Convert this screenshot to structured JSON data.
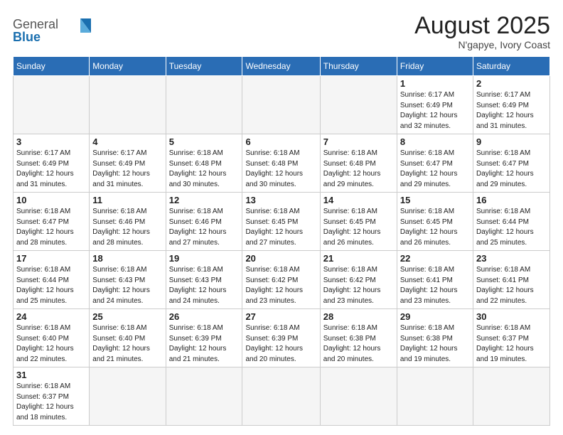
{
  "logo": {
    "text_general": "General",
    "text_blue": "Blue"
  },
  "title": {
    "month_year": "August 2025",
    "location": "N'gapye, Ivory Coast"
  },
  "weekdays": [
    "Sunday",
    "Monday",
    "Tuesday",
    "Wednesday",
    "Thursday",
    "Friday",
    "Saturday"
  ],
  "weeks": [
    [
      {
        "day": "",
        "info": ""
      },
      {
        "day": "",
        "info": ""
      },
      {
        "day": "",
        "info": ""
      },
      {
        "day": "",
        "info": ""
      },
      {
        "day": "",
        "info": ""
      },
      {
        "day": "1",
        "info": "Sunrise: 6:17 AM\nSunset: 6:49 PM\nDaylight: 12 hours\nand 32 minutes."
      },
      {
        "day": "2",
        "info": "Sunrise: 6:17 AM\nSunset: 6:49 PM\nDaylight: 12 hours\nand 31 minutes."
      }
    ],
    [
      {
        "day": "3",
        "info": "Sunrise: 6:17 AM\nSunset: 6:49 PM\nDaylight: 12 hours\nand 31 minutes."
      },
      {
        "day": "4",
        "info": "Sunrise: 6:17 AM\nSunset: 6:49 PM\nDaylight: 12 hours\nand 31 minutes."
      },
      {
        "day": "5",
        "info": "Sunrise: 6:18 AM\nSunset: 6:48 PM\nDaylight: 12 hours\nand 30 minutes."
      },
      {
        "day": "6",
        "info": "Sunrise: 6:18 AM\nSunset: 6:48 PM\nDaylight: 12 hours\nand 30 minutes."
      },
      {
        "day": "7",
        "info": "Sunrise: 6:18 AM\nSunset: 6:48 PM\nDaylight: 12 hours\nand 29 minutes."
      },
      {
        "day": "8",
        "info": "Sunrise: 6:18 AM\nSunset: 6:47 PM\nDaylight: 12 hours\nand 29 minutes."
      },
      {
        "day": "9",
        "info": "Sunrise: 6:18 AM\nSunset: 6:47 PM\nDaylight: 12 hours\nand 29 minutes."
      }
    ],
    [
      {
        "day": "10",
        "info": "Sunrise: 6:18 AM\nSunset: 6:47 PM\nDaylight: 12 hours\nand 28 minutes."
      },
      {
        "day": "11",
        "info": "Sunrise: 6:18 AM\nSunset: 6:46 PM\nDaylight: 12 hours\nand 28 minutes."
      },
      {
        "day": "12",
        "info": "Sunrise: 6:18 AM\nSunset: 6:46 PM\nDaylight: 12 hours\nand 27 minutes."
      },
      {
        "day": "13",
        "info": "Sunrise: 6:18 AM\nSunset: 6:45 PM\nDaylight: 12 hours\nand 27 minutes."
      },
      {
        "day": "14",
        "info": "Sunrise: 6:18 AM\nSunset: 6:45 PM\nDaylight: 12 hours\nand 26 minutes."
      },
      {
        "day": "15",
        "info": "Sunrise: 6:18 AM\nSunset: 6:45 PM\nDaylight: 12 hours\nand 26 minutes."
      },
      {
        "day": "16",
        "info": "Sunrise: 6:18 AM\nSunset: 6:44 PM\nDaylight: 12 hours\nand 25 minutes."
      }
    ],
    [
      {
        "day": "17",
        "info": "Sunrise: 6:18 AM\nSunset: 6:44 PM\nDaylight: 12 hours\nand 25 minutes."
      },
      {
        "day": "18",
        "info": "Sunrise: 6:18 AM\nSunset: 6:43 PM\nDaylight: 12 hours\nand 24 minutes."
      },
      {
        "day": "19",
        "info": "Sunrise: 6:18 AM\nSunset: 6:43 PM\nDaylight: 12 hours\nand 24 minutes."
      },
      {
        "day": "20",
        "info": "Sunrise: 6:18 AM\nSunset: 6:42 PM\nDaylight: 12 hours\nand 23 minutes."
      },
      {
        "day": "21",
        "info": "Sunrise: 6:18 AM\nSunset: 6:42 PM\nDaylight: 12 hours\nand 23 minutes."
      },
      {
        "day": "22",
        "info": "Sunrise: 6:18 AM\nSunset: 6:41 PM\nDaylight: 12 hours\nand 23 minutes."
      },
      {
        "day": "23",
        "info": "Sunrise: 6:18 AM\nSunset: 6:41 PM\nDaylight: 12 hours\nand 22 minutes."
      }
    ],
    [
      {
        "day": "24",
        "info": "Sunrise: 6:18 AM\nSunset: 6:40 PM\nDaylight: 12 hours\nand 22 minutes."
      },
      {
        "day": "25",
        "info": "Sunrise: 6:18 AM\nSunset: 6:40 PM\nDaylight: 12 hours\nand 21 minutes."
      },
      {
        "day": "26",
        "info": "Sunrise: 6:18 AM\nSunset: 6:39 PM\nDaylight: 12 hours\nand 21 minutes."
      },
      {
        "day": "27",
        "info": "Sunrise: 6:18 AM\nSunset: 6:39 PM\nDaylight: 12 hours\nand 20 minutes."
      },
      {
        "day": "28",
        "info": "Sunrise: 6:18 AM\nSunset: 6:38 PM\nDaylight: 12 hours\nand 20 minutes."
      },
      {
        "day": "29",
        "info": "Sunrise: 6:18 AM\nSunset: 6:38 PM\nDaylight: 12 hours\nand 19 minutes."
      },
      {
        "day": "30",
        "info": "Sunrise: 6:18 AM\nSunset: 6:37 PM\nDaylight: 12 hours\nand 19 minutes."
      }
    ],
    [
      {
        "day": "31",
        "info": "Sunrise: 6:18 AM\nSunset: 6:37 PM\nDaylight: 12 hours\nand 18 minutes."
      },
      {
        "day": "",
        "info": ""
      },
      {
        "day": "",
        "info": ""
      },
      {
        "day": "",
        "info": ""
      },
      {
        "day": "",
        "info": ""
      },
      {
        "day": "",
        "info": ""
      },
      {
        "day": "",
        "info": ""
      }
    ]
  ]
}
